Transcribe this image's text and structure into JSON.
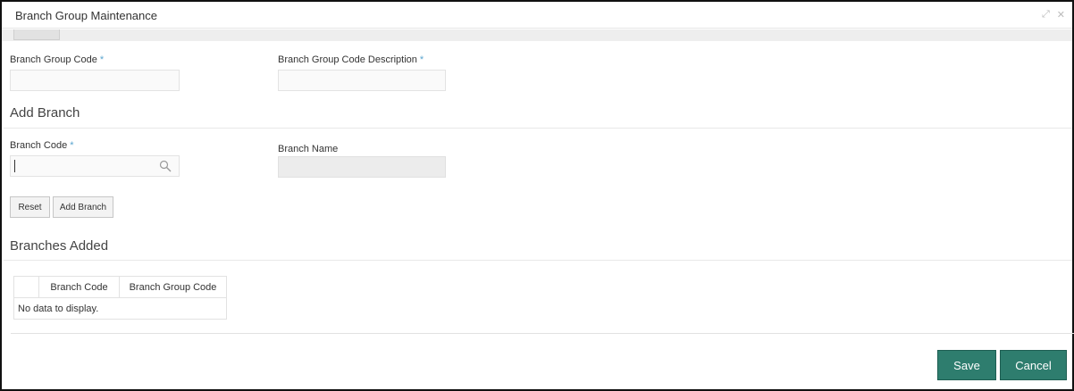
{
  "window": {
    "title": "Branch Group Maintenance",
    "controls": [
      "expand-icon",
      "close-icon"
    ]
  },
  "form": {
    "branch_group_code": {
      "label": "Branch Group Code",
      "required_mark": "*",
      "value": ""
    },
    "branch_group_desc": {
      "label": "Branch Group Code Description",
      "required_mark": "*",
      "value": ""
    }
  },
  "add_branch": {
    "heading": "Add Branch",
    "branch_code": {
      "label": "Branch Code",
      "required_mark": "*",
      "value": ""
    },
    "branch_name": {
      "label": "Branch Name",
      "value": ""
    },
    "reset_label": "Reset",
    "add_label": "Add Branch"
  },
  "branches_added": {
    "heading": "Branches Added",
    "columns": [
      "",
      "Branch Code",
      "Branch Group Code"
    ],
    "empty_text": "No data to display."
  },
  "footer": {
    "save_label": "Save",
    "cancel_label": "Cancel"
  },
  "colors": {
    "primary_button": "#2e7d6e",
    "required_asterisk": "#5aa5cf"
  }
}
